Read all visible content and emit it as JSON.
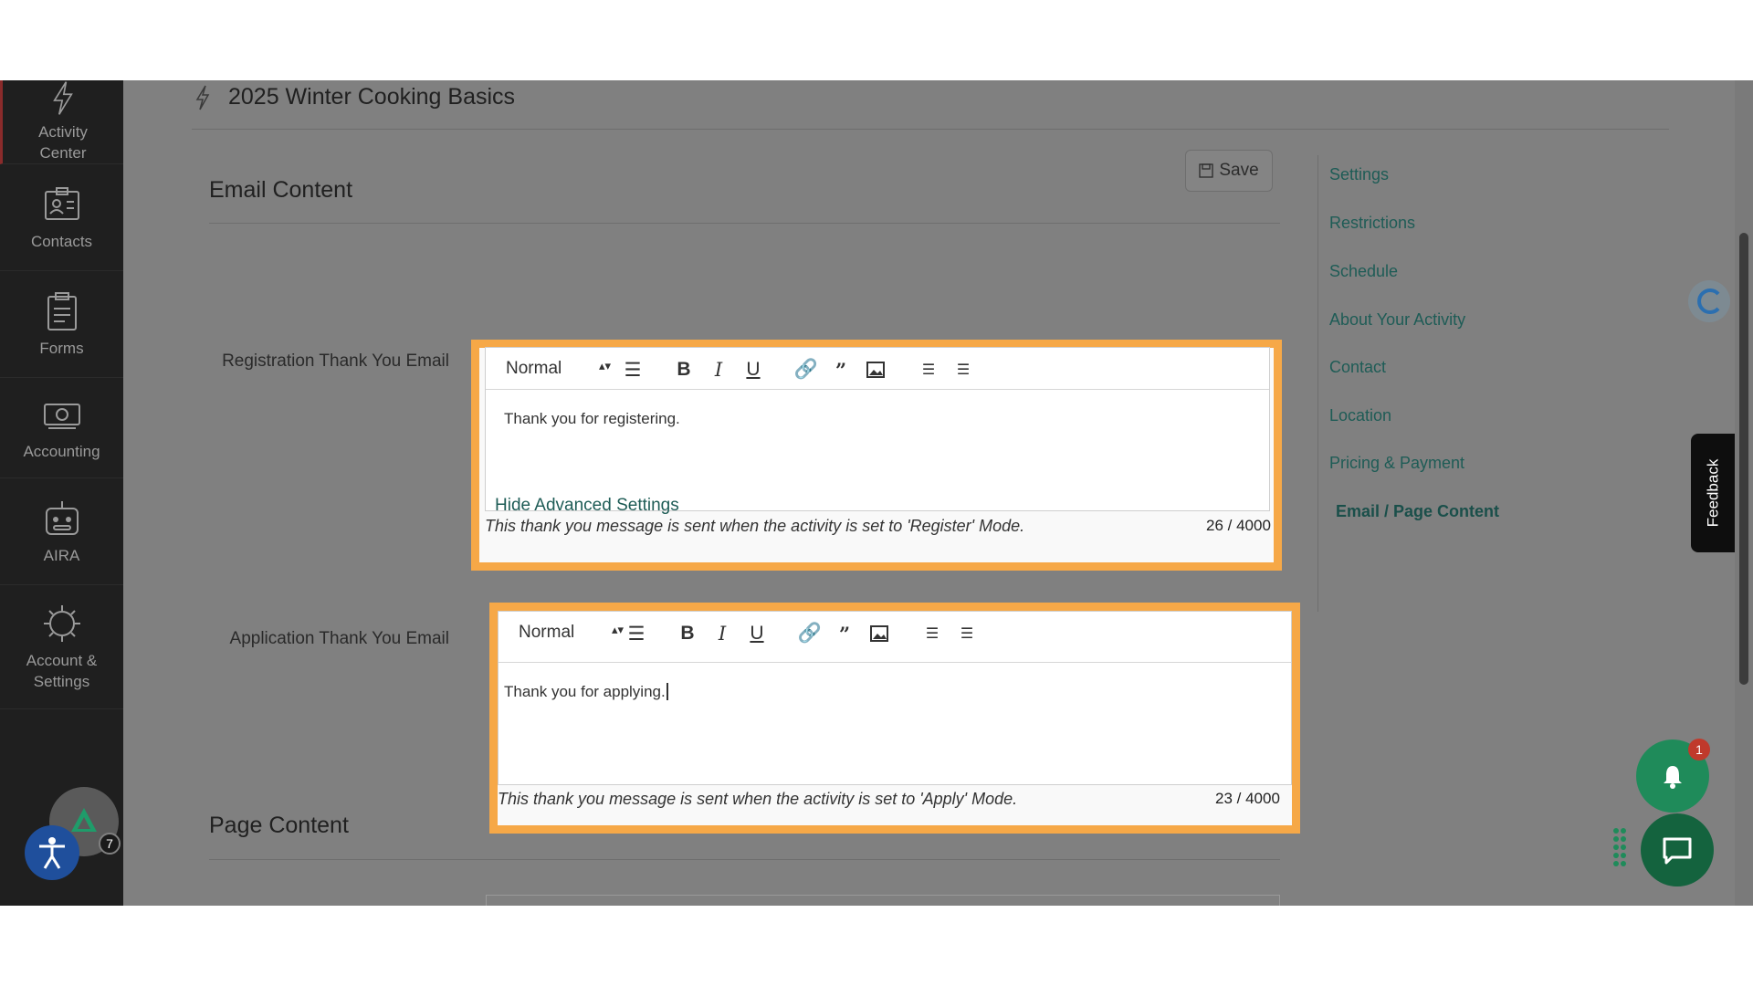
{
  "sidebar": {
    "items": [
      {
        "label": "Activity\nCenter",
        "icon": "bolt-icon"
      },
      {
        "label": "Contacts",
        "icon": "contact-card-icon"
      },
      {
        "label": "Forms",
        "icon": "clipboard-icon"
      },
      {
        "label": "Accounting",
        "icon": "money-icon"
      },
      {
        "label": "AIRA",
        "icon": "robot-icon"
      },
      {
        "label": "Account &\nSettings",
        "icon": "gear-icon"
      }
    ],
    "accessibility_badge": "7"
  },
  "header": {
    "title": "2025 Winter Cooking Basics"
  },
  "email_content": {
    "heading": "Email Content",
    "save_label": "Save",
    "registration": {
      "label": "Registration Thank You Email",
      "format": "Normal",
      "body": "Thank you for registering.",
      "help": "This thank you message is sent when the activity is set to 'Register' Mode.",
      "counter": "26 / 4000"
    },
    "hide_advanced": "Hide Advanced Settings",
    "application": {
      "label": "Application Thank You Email",
      "format": "Normal",
      "body": "Thank you for applying.",
      "help": "This thank you message is sent when the activity is set to 'Apply' Mode.",
      "counter": "23 / 4000"
    }
  },
  "page_content": {
    "heading": "Page Content"
  },
  "right_nav": {
    "items": [
      "Settings",
      "Restrictions",
      "Schedule",
      "About Your Activity",
      "Contact",
      "Location",
      "Pricing & Payment",
      "Email / Page Content"
    ],
    "active": "Email / Page Content"
  },
  "feedback_label": "Feedback",
  "notifications_badge": "1",
  "colors": {
    "highlight": "#f6a847",
    "link": "#1e5c56",
    "sidebar_bg": "#1f1f1f"
  }
}
